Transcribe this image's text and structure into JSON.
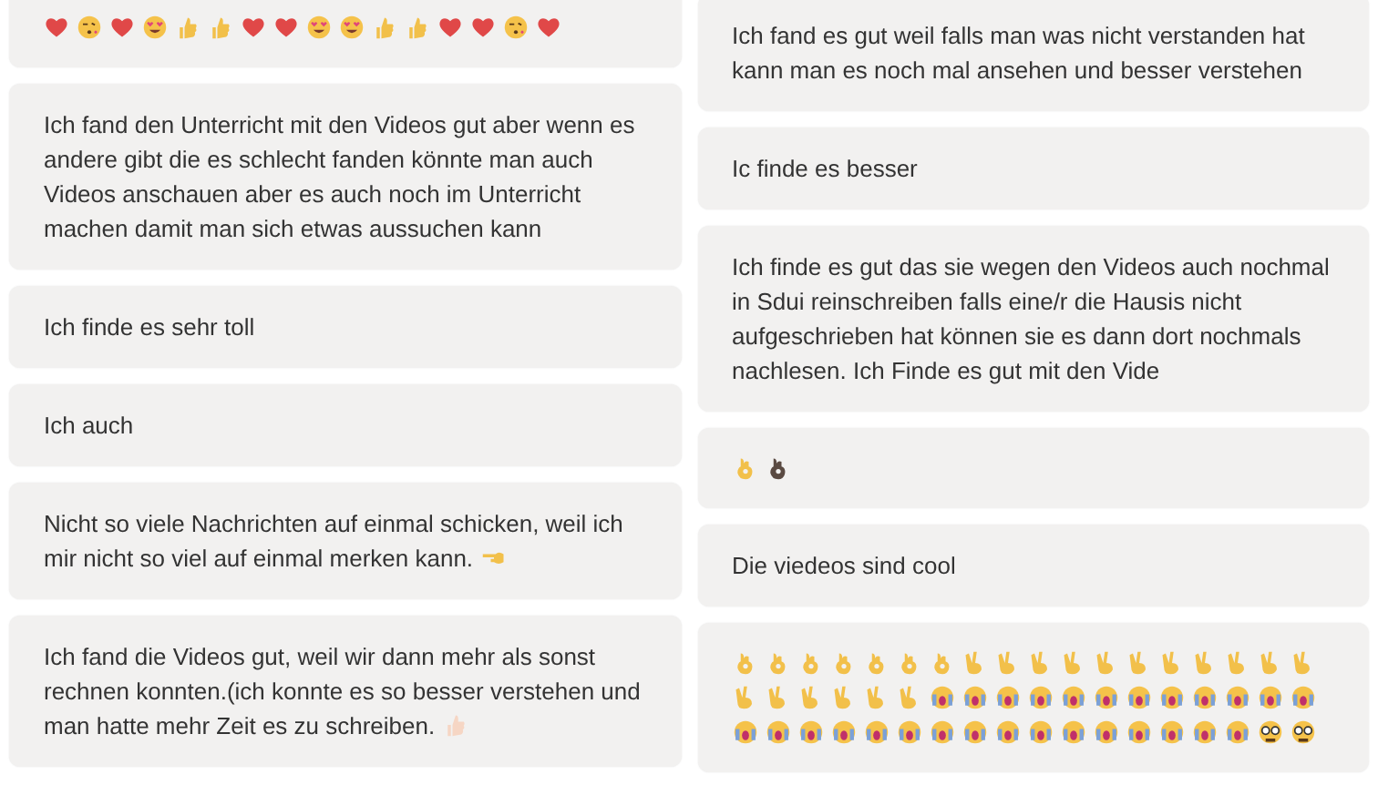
{
  "columns": [
    {
      "messages": [
        {
          "emojis": [
            {
              "kind": "heart"
            },
            {
              "kind": "kiss-face"
            },
            {
              "kind": "heart"
            },
            {
              "kind": "heart-eyes"
            },
            {
              "kind": "thumbs-up"
            },
            {
              "kind": "thumbs-up"
            },
            {
              "kind": "heart"
            },
            {
              "kind": "heart"
            },
            {
              "kind": "heart-eyes"
            },
            {
              "kind": "heart-eyes"
            },
            {
              "kind": "thumbs-up"
            },
            {
              "kind": "thumbs-up"
            },
            {
              "kind": "heart"
            },
            {
              "kind": "heart"
            },
            {
              "kind": "kiss-face"
            },
            {
              "kind": "heart"
            }
          ]
        },
        {
          "text": "Ich fand den Unterricht mit den Videos gut aber wenn es andere gibt die es schlecht fanden könnte man auch Videos anschauen aber es auch noch im Unterricht machen damit man sich etwas aussuchen kann"
        },
        {
          "text": "Ich finde es sehr toll"
        },
        {
          "text": "Ich auch"
        },
        {
          "text": "Nicht so viele Nachrichten auf einmal schicken, weil ich mir nicht so viel auf einmal merken kann.",
          "emojis": [
            {
              "kind": "pointing-hand"
            }
          ]
        },
        {
          "text": "Ich fand die Videos gut, weil wir dann mehr als sonst rechnen konnten.(ich konnte es so besser verstehen und man hatte mehr Zeit es zu schreiben.",
          "emojis": [
            {
              "kind": "pale-thumbs-up"
            }
          ]
        }
      ]
    },
    {
      "messages": [
        {
          "text": "Ich fand es gut weil falls man was nicht verstanden hat kann man es noch mal ansehen und besser verstehen"
        },
        {
          "text": "Ic finde es besser"
        },
        {
          "text": "Ich finde es gut das sie wegen den Videos auch nochmal in Sdui reinschreiben falls eine/r die Hausis nicht aufgeschrieben hat können sie es dann dort nochmals nachlesen. Ich Finde es gut mit den Vide"
        },
        {
          "emojis": [
            {
              "kind": "ok-hand"
            },
            {
              "kind": "dark-ok-hand"
            }
          ]
        },
        {
          "text": "Die viedeos sind cool"
        },
        {
          "emojis": [
            {
              "kind": "ok-hand"
            },
            {
              "kind": "ok-hand"
            },
            {
              "kind": "ok-hand"
            },
            {
              "kind": "ok-hand"
            },
            {
              "kind": "ok-hand"
            },
            {
              "kind": "ok-hand"
            },
            {
              "kind": "ok-hand"
            },
            {
              "kind": "victory-hand"
            },
            {
              "kind": "victory-hand"
            },
            {
              "kind": "victory-hand"
            },
            {
              "kind": "victory-hand"
            },
            {
              "kind": "victory-hand"
            },
            {
              "kind": "victory-hand"
            },
            {
              "kind": "victory-hand"
            },
            {
              "kind": "victory-hand"
            },
            {
              "kind": "victory-hand"
            },
            {
              "kind": "victory-hand"
            },
            {
              "kind": "victory-hand"
            },
            {
              "kind": "victory-hand"
            },
            {
              "kind": "victory-hand"
            },
            {
              "kind": "victory-hand"
            },
            {
              "kind": "victory-hand"
            },
            {
              "kind": "victory-hand"
            },
            {
              "kind": "victory-hand"
            },
            {
              "kind": "crying-face"
            },
            {
              "kind": "crying-face"
            },
            {
              "kind": "crying-face"
            },
            {
              "kind": "crying-face"
            },
            {
              "kind": "crying-face"
            },
            {
              "kind": "crying-face"
            },
            {
              "kind": "crying-face"
            },
            {
              "kind": "crying-face"
            },
            {
              "kind": "crying-face"
            },
            {
              "kind": "crying-face"
            },
            {
              "kind": "crying-face"
            },
            {
              "kind": "crying-face"
            },
            {
              "kind": "crying-face"
            },
            {
              "kind": "crying-face"
            },
            {
              "kind": "crying-face"
            },
            {
              "kind": "crying-face"
            },
            {
              "kind": "crying-face"
            },
            {
              "kind": "crying-face"
            },
            {
              "kind": "crying-face"
            },
            {
              "kind": "crying-face"
            },
            {
              "kind": "crying-face"
            },
            {
              "kind": "crying-face"
            },
            {
              "kind": "crying-face"
            },
            {
              "kind": "crying-face"
            },
            {
              "kind": "crying-face"
            },
            {
              "kind": "crying-face"
            },
            {
              "kind": "crying-face"
            },
            {
              "kind": "crying-face"
            },
            {
              "kind": "nerd-face"
            },
            {
              "kind": "nerd-face"
            }
          ]
        }
      ]
    }
  ]
}
